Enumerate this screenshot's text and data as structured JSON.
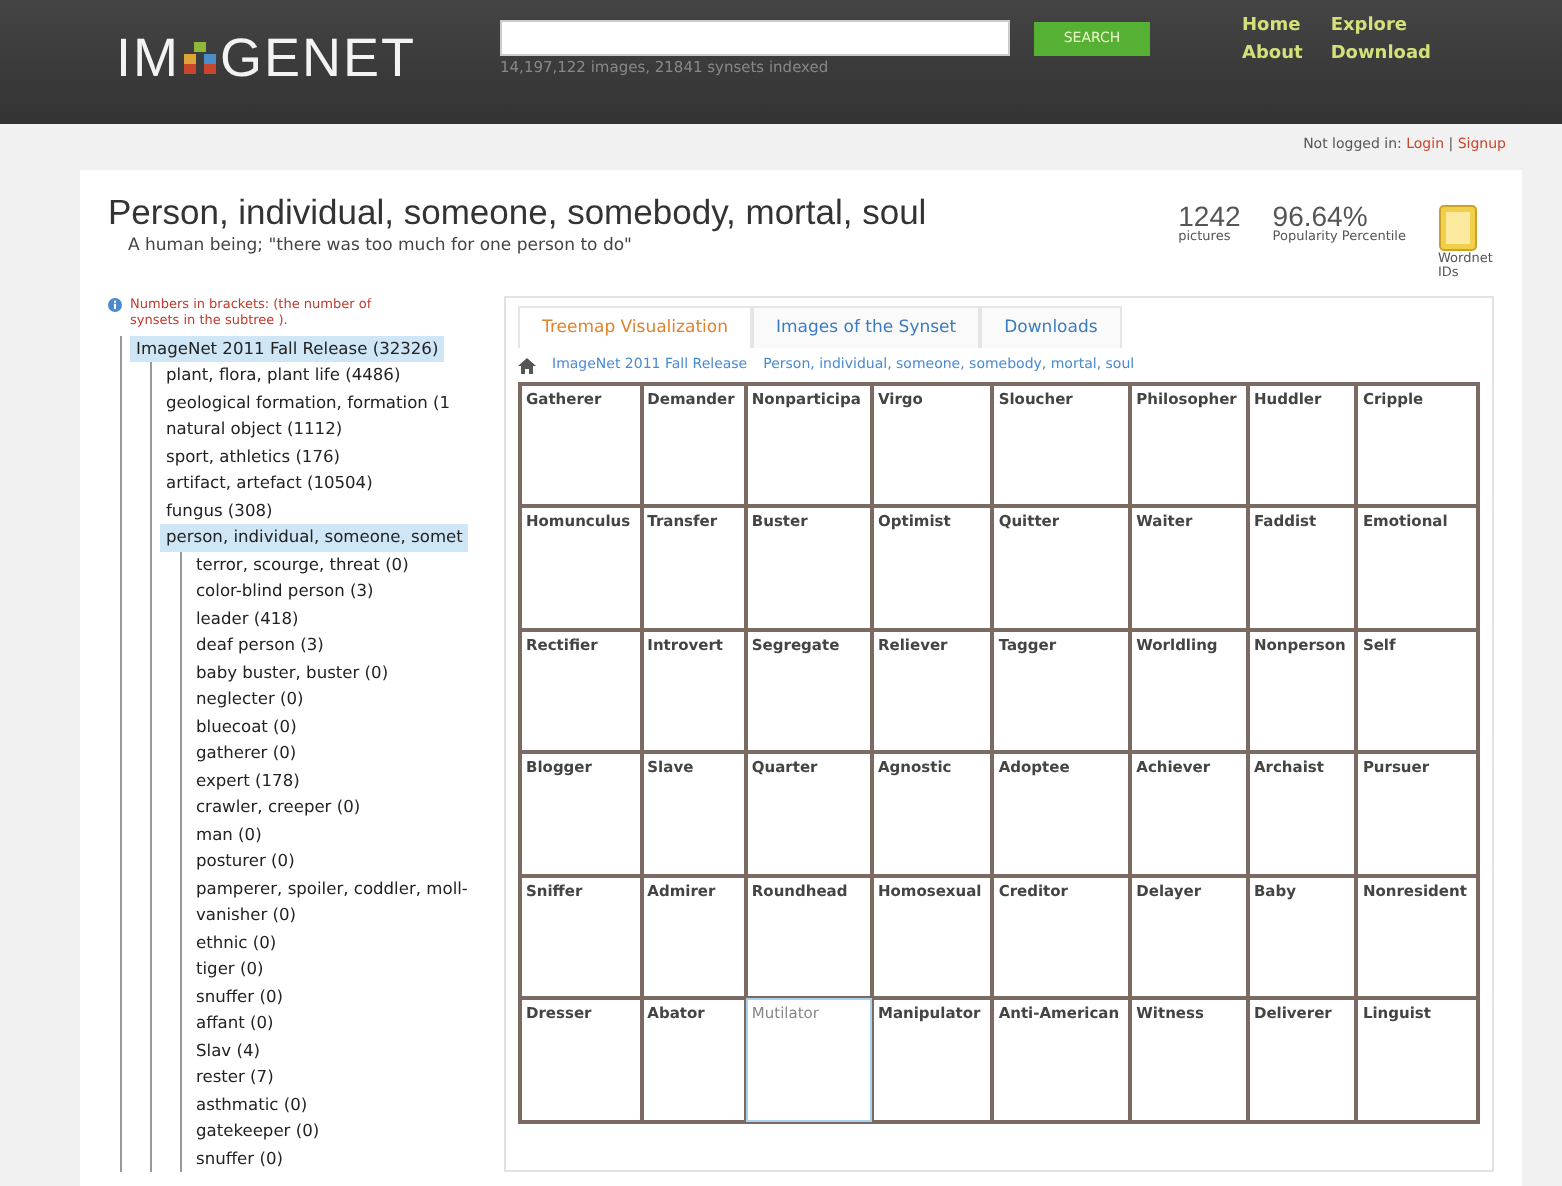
{
  "header": {
    "logo": {
      "left": "IM",
      "right": "GENET"
    },
    "search": {
      "button": "SEARCH",
      "stats": "14,197,122 images, 21841 synsets indexed"
    },
    "nav": [
      "Home",
      "Explore",
      "About",
      "Download"
    ]
  },
  "login": {
    "status": "Not logged in:",
    "links": [
      "Login",
      "Signup"
    ],
    "separator": "|"
  },
  "synset": {
    "title": "Person, individual, someone, somebody, mortal, soul",
    "gloss": "A human being; \"there was too much for one person to do\"",
    "stats": [
      {
        "value": "1242",
        "label": "pictures"
      },
      {
        "value": "96.64%",
        "label": "Popularity Percentile"
      }
    ],
    "wordnet": "Wordnet IDs"
  },
  "sidebar": {
    "note": "Numbers in brackets: (the number of synsets in the subtree ).",
    "tree": [
      {
        "label": "ImageNet 2011 Fall Release (32326)",
        "selected": true,
        "children": [
          {
            "label": "plant, flora, plant life (4486)",
            "selected": false
          },
          {
            "label": "geological formation, formation (1",
            "selected": false
          },
          {
            "label": "natural object (1112)",
            "selected": false
          },
          {
            "label": "sport, athletics (176)",
            "selected": false
          },
          {
            "label": "artifact, artefact (10504)",
            "selected": false
          },
          {
            "label": "fungus (308)",
            "selected": false
          },
          {
            "label": "person, individual, someone, somet",
            "selected": true,
            "children": [
              {
                "label": "terror, scourge, threat (0)",
                "selected": false
              },
              {
                "label": "color-blind person (3)",
                "selected": false
              },
              {
                "label": "leader (418)",
                "selected": false
              },
              {
                "label": "deaf person (3)",
                "selected": false
              },
              {
                "label": "baby buster, buster (0)",
                "selected": false
              },
              {
                "label": "neglecter (0)",
                "selected": false
              },
              {
                "label": "bluecoat (0)",
                "selected": false
              },
              {
                "label": "gatherer (0)",
                "selected": false
              },
              {
                "label": "expert (178)",
                "selected": false
              },
              {
                "label": "crawler, creeper (0)",
                "selected": false
              },
              {
                "label": "man (0)",
                "selected": false
              },
              {
                "label": "posturer (0)",
                "selected": false
              },
              {
                "label": "pamperer, spoiler, coddler, moll-",
                "selected": false
              },
              {
                "label": "vanisher (0)",
                "selected": false
              },
              {
                "label": "ethnic (0)",
                "selected": false
              },
              {
                "label": "tiger (0)",
                "selected": false
              },
              {
                "label": "snuffer (0)",
                "selected": false
              },
              {
                "label": "affant (0)",
                "selected": false
              },
              {
                "label": "Slav (4)",
                "selected": false
              },
              {
                "label": "rester (7)",
                "selected": false
              },
              {
                "label": "asthmatic (0)",
                "selected": false
              },
              {
                "label": "gatekeeper (0)",
                "selected": false
              },
              {
                "label": "snuffer (0)",
                "selected": false
              }
            ]
          }
        ]
      }
    ]
  },
  "tabs": [
    {
      "label": "Treemap Visualization",
      "selected": true
    },
    {
      "label": "Images of the Synset",
      "selected": false
    },
    {
      "label": "Downloads",
      "selected": false
    }
  ],
  "breadcrumb": [
    "ImageNet 2011 Fall Release",
    "Person, individual, someone, somebody, mortal, soul"
  ],
  "treemap": [
    {
      "label": "Gatherer",
      "highlighted": false
    },
    {
      "label": "Demander",
      "highlighted": false
    },
    {
      "label": "Nonparticipa",
      "highlighted": false
    },
    {
      "label": "Virgo",
      "highlighted": false
    },
    {
      "label": "Sloucher",
      "highlighted": false
    },
    {
      "label": "Philosopher",
      "highlighted": false
    },
    {
      "label": "Huddler",
      "highlighted": false
    },
    {
      "label": "Cripple",
      "highlighted": false
    },
    {
      "label": "Homunculus",
      "highlighted": false
    },
    {
      "label": "Transfer",
      "highlighted": false
    },
    {
      "label": "Buster",
      "highlighted": false
    },
    {
      "label": "Optimist",
      "highlighted": false
    },
    {
      "label": "Quitter",
      "highlighted": false
    },
    {
      "label": "Waiter",
      "highlighted": false
    },
    {
      "label": "Faddist",
      "highlighted": false
    },
    {
      "label": "Emotional",
      "highlighted": false
    },
    {
      "label": "Rectifier",
      "highlighted": false
    },
    {
      "label": "Introvert",
      "highlighted": false
    },
    {
      "label": "Segregate",
      "highlighted": false
    },
    {
      "label": "Reliever",
      "highlighted": false
    },
    {
      "label": "Tagger",
      "highlighted": false
    },
    {
      "label": "Worldling",
      "highlighted": false
    },
    {
      "label": "Nonperson",
      "highlighted": false
    },
    {
      "label": "Self",
      "highlighted": false
    },
    {
      "label": "Blogger",
      "highlighted": false
    },
    {
      "label": "Slave",
      "highlighted": false
    },
    {
      "label": "Quarter",
      "highlighted": false
    },
    {
      "label": "Agnostic",
      "highlighted": false
    },
    {
      "label": "Adoptee",
      "highlighted": false
    },
    {
      "label": "Achiever",
      "highlighted": false
    },
    {
      "label": "Archaist",
      "highlighted": false
    },
    {
      "label": "Pursuer",
      "highlighted": false
    },
    {
      "label": "Sniffer",
      "highlighted": false
    },
    {
      "label": "Admirer",
      "highlighted": false
    },
    {
      "label": "Roundhead",
      "highlighted": false
    },
    {
      "label": "Homosexual",
      "highlighted": false
    },
    {
      "label": "Creditor",
      "highlighted": false
    },
    {
      "label": "Delayer",
      "highlighted": false
    },
    {
      "label": "Baby",
      "highlighted": false
    },
    {
      "label": "Nonresident",
      "highlighted": false
    },
    {
      "label": "Dresser",
      "highlighted": false
    },
    {
      "label": "Abator",
      "highlighted": false
    },
    {
      "label": "Mutilator",
      "highlighted": true
    },
    {
      "label": "Manipulator",
      "highlighted": false
    },
    {
      "label": "Anti-American",
      "highlighted": false
    },
    {
      "label": "Witness",
      "highlighted": false
    },
    {
      "label": "Deliverer",
      "highlighted": false
    },
    {
      "label": "Linguist",
      "highlighted": false
    }
  ]
}
